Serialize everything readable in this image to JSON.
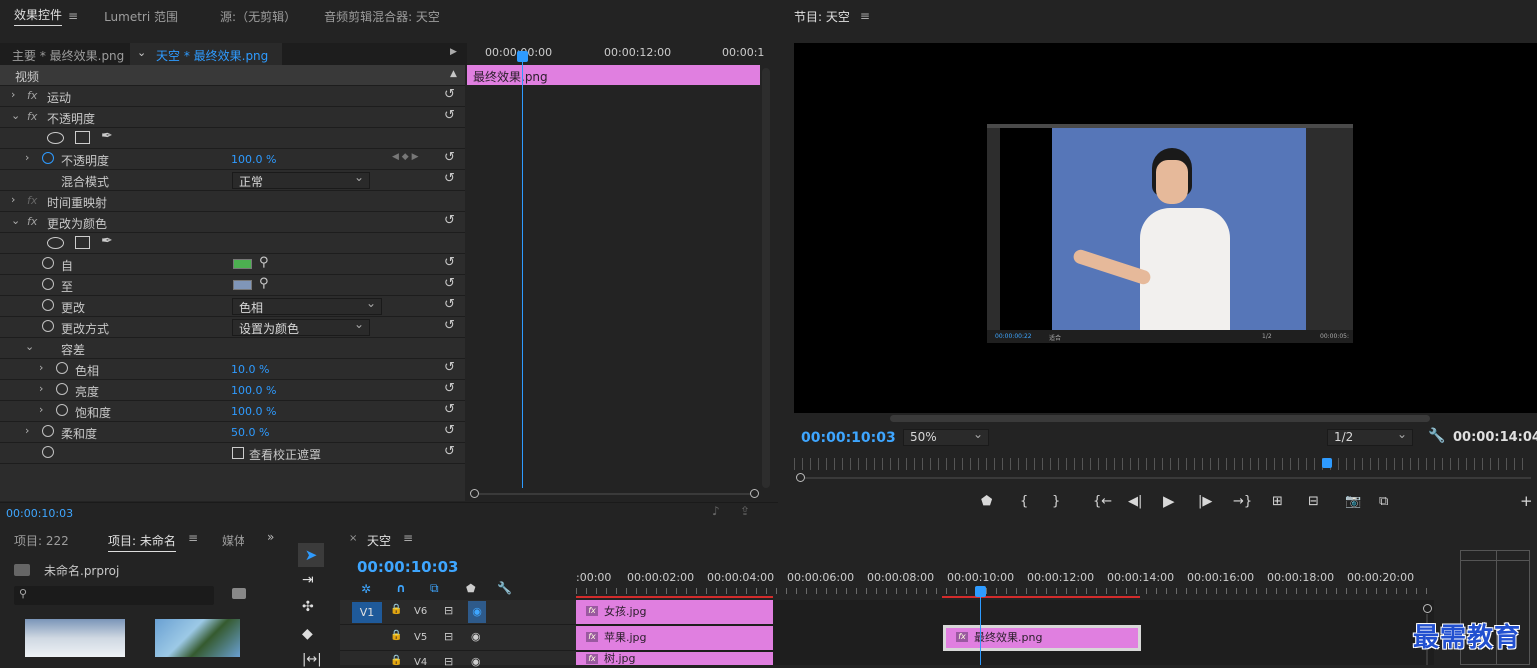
{
  "top_tabs": {
    "effect_controls": "效果控件",
    "lumetri": "Lumetri 范围",
    "source": "源:（无剪辑）",
    "audio_mixer": "音频剪辑混合器: 天空"
  },
  "ec": {
    "master": "主要 * 最终效果.png",
    "clip": "天空 * 最终效果.png",
    "section": "视频",
    "ruler": [
      "00:00:00:00",
      "00:00:12:00",
      "00:00:1"
    ],
    "clip_bar": "最终效果.png",
    "timecode": "00:00:10:03"
  },
  "effects": {
    "motion": "运动",
    "opacity": "不透明度",
    "opacity_param": "不透明度",
    "opacity_value": "100.0 %",
    "blend": "混合模式",
    "blend_value": "正常",
    "time_remap": "时间重映射",
    "change_color": "更改为颜色",
    "from": "自",
    "to": "至",
    "change": "更改",
    "change_value": "色相",
    "change_by": "更改方式",
    "change_by_value": "设置为颜色",
    "tolerance": "容差",
    "hue": "色相",
    "hue_value": "10.0 %",
    "lightness": "亮度",
    "lightness_value": "100.0 %",
    "saturation": "饱和度",
    "saturation_value": "100.0 %",
    "softness": "柔和度",
    "softness_value": "50.0 %",
    "view_mask": "查看校正遮罩",
    "from_color": "#4caf50",
    "to_color": "#8096b8"
  },
  "program": {
    "title": "节目: 天空",
    "timecode": "00:00:10:03",
    "zoom": "50%",
    "resolution": "1/2",
    "duration": "00:00:14:04",
    "inner_tc": "00:00:00:22",
    "inner_fit": "适合",
    "inner_res": "1/2",
    "inner_dur": "00:00:05:"
  },
  "project": {
    "tab1": "项目: 222",
    "tab2": "项目: 未命名",
    "tab3": "媒体",
    "file": "未命名.prproj",
    "search_placeholder": ""
  },
  "timeline": {
    "title": "天空",
    "timecode": "00:00:10:03",
    "ruler": [
      ":00:00",
      "00:00:02:00",
      "00:00:04:00",
      "00:00:06:00",
      "00:00:08:00",
      "00:00:10:00",
      "00:00:12:00",
      "00:00:14:00",
      "00:00:16:00",
      "00:00:18:00",
      "00:00:20:00"
    ],
    "tracks": [
      {
        "src": "V1",
        "name": "V6"
      },
      {
        "src": "",
        "name": "V5"
      },
      {
        "src": "",
        "name": "V4"
      }
    ],
    "clips": {
      "girl": "女孩.jpg",
      "apple": "苹果.jpg",
      "tree": "树.jpg",
      "final": "最终效果.png"
    }
  },
  "watermark": "最需教育",
  "colors": {
    "accent": "#2e9bff",
    "clip": "#e07fe0",
    "bg": "#232323"
  }
}
